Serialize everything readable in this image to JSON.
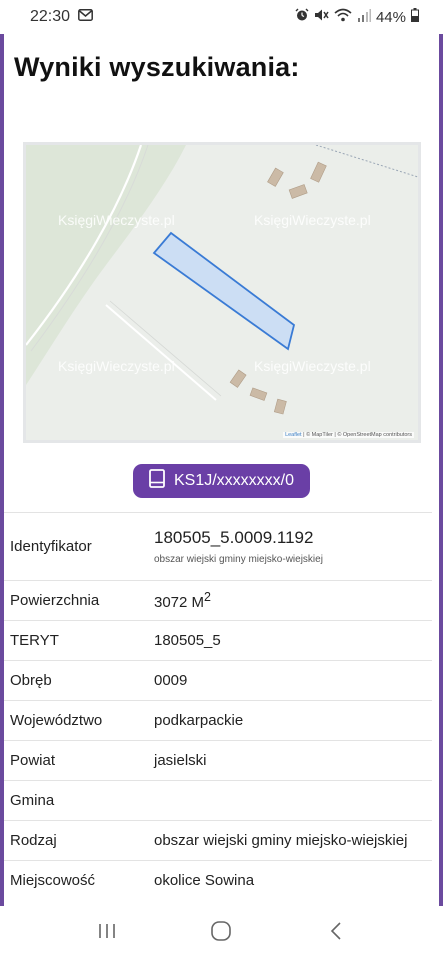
{
  "status_bar": {
    "time": "22:30",
    "battery": "44%",
    "icons": [
      "gmail-icon",
      "alarm-icon",
      "mute-icon",
      "wifi-icon",
      "signal-icon",
      "battery-icon"
    ]
  },
  "page": {
    "title": "Wyniki wyszukiwania:"
  },
  "map": {
    "watermarks": [
      "KsięgiWieczyste.pl",
      "KsięgiWieczyste.pl",
      "KsięgiWieczyste.pl",
      "KsięgiWieczyste.pl"
    ],
    "attribution_leaflet": "Leaflet",
    "attribution_rest": "| © MapTiler | © OpenStreetMap contributors",
    "parcel_fill": "#c9dcf5",
    "parcel_stroke": "#3a7bd5"
  },
  "kw_button": {
    "label": "KS1J/xxxxxxxx/0",
    "icon": "book-icon",
    "color": "#6a3fa6"
  },
  "details": {
    "identyfikator": {
      "label": "Identyfikator",
      "value": "180505_5.0009.1192",
      "sub": "obszar wiejski gminy miejsko-wiejskiej"
    },
    "powierzchnia": {
      "label": "Powierzchnia",
      "value": "3072 M",
      "sup": "2"
    },
    "teryt": {
      "label": "TERYT",
      "value": "180505_5"
    },
    "obreb": {
      "label": "Obręb",
      "value": "0009"
    },
    "wojewodztwo": {
      "label": "Województwo",
      "value": "podkarpackie"
    },
    "powiat": {
      "label": "Powiat",
      "value": "jasielski"
    },
    "gmina": {
      "label": "Gmina",
      "value": ""
    },
    "rodzaj": {
      "label": "Rodzaj",
      "value": "obszar wiejski gminy miejsko-wiejskiej"
    },
    "miejscowosc": {
      "label": "Miejscowość",
      "value": "okolice Sowina"
    }
  },
  "nav": {
    "recent_icon": "recent-apps-icon",
    "home_icon": "home-icon",
    "back_icon": "back-icon"
  },
  "colors": {
    "accent": "#6a3fa6",
    "frame_border": "#6b4a9e"
  }
}
